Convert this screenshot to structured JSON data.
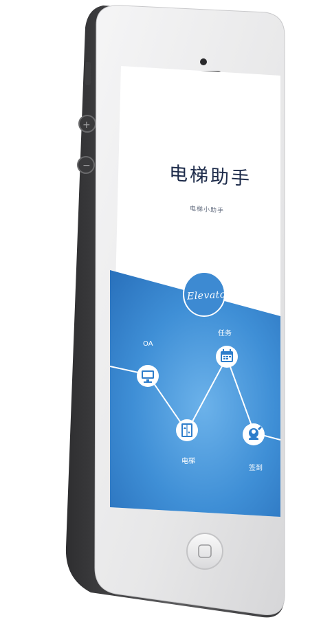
{
  "app": {
    "title": "电梯助手",
    "subtitle": "电梯小助手",
    "badge": "Elevator"
  },
  "nodes": [
    {
      "id": "oa",
      "label": "OA",
      "icon": "monitor-icon"
    },
    {
      "id": "elevator",
      "label": "电梯",
      "icon": "elevator-icon"
    },
    {
      "id": "task",
      "label": "任务",
      "icon": "calendar-icon"
    },
    {
      "id": "checkin",
      "label": "签到",
      "icon": "signin-icon"
    }
  ],
  "colors": {
    "screen_bg": "#ffffff",
    "accent_blue": "#2f7ecb",
    "accent_blue_light": "#62a8e4",
    "title_text": "#1d2b4a",
    "phone_frame": "#e9e9ea",
    "phone_edge": "#4d4d4f"
  }
}
